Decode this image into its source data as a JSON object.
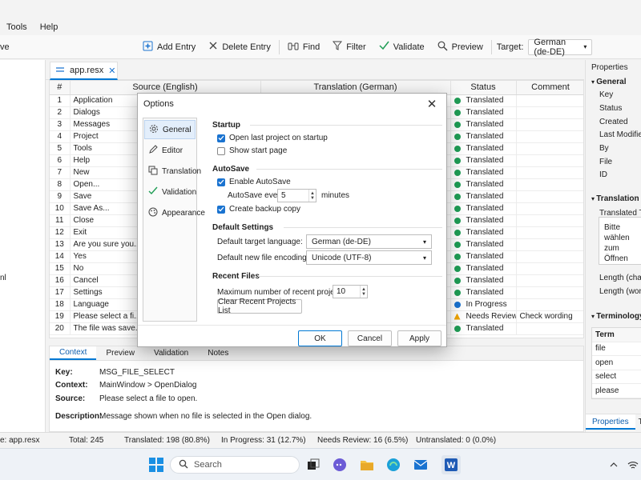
{
  "menu": {
    "tools": "Tools",
    "help": "Help"
  },
  "toolbar": {
    "left_fragment": "ve",
    "add_entry": "Add Entry",
    "delete_entry": "Delete Entry",
    "find": "Find",
    "filter": "Filter",
    "validate": "Validate",
    "preview": "Preview",
    "target_label": "Target:",
    "target_value": "German (de-DE)"
  },
  "left_pane": {
    "fragment": "nl"
  },
  "doc_tab": {
    "label": "app.resx"
  },
  "grid": {
    "headers": [
      "#",
      "Source (English)",
      "Translation (German)",
      "Status",
      "Comment"
    ],
    "rows": [
      {
        "n": "1",
        "src": "Application",
        "status": "Translated",
        "comment": ""
      },
      {
        "n": "2",
        "src": "Dialogs",
        "status": "Translated",
        "comment": ""
      },
      {
        "n": "3",
        "src": "Messages",
        "status": "Translated",
        "comment": ""
      },
      {
        "n": "4",
        "src": "Project",
        "status": "Translated",
        "comment": ""
      },
      {
        "n": "5",
        "src": "Tools",
        "status": "Translated",
        "comment": ""
      },
      {
        "n": "6",
        "src": "Help",
        "status": "Translated",
        "comment": ""
      },
      {
        "n": "7",
        "src": "New",
        "status": "Translated",
        "comment": ""
      },
      {
        "n": "8",
        "src": "Open...",
        "status": "Translated",
        "comment": ""
      },
      {
        "n": "9",
        "src": "Save",
        "status": "Translated",
        "comment": ""
      },
      {
        "n": "10",
        "src": "Save As...",
        "status": "Translated",
        "comment": ""
      },
      {
        "n": "11",
        "src": "Close",
        "status": "Translated",
        "comment": ""
      },
      {
        "n": "12",
        "src": "Exit",
        "status": "Translated",
        "comment": ""
      },
      {
        "n": "13",
        "src": "Are you sure you...",
        "status": "Translated",
        "comment": ""
      },
      {
        "n": "14",
        "src": "Yes",
        "status": "Translated",
        "comment": ""
      },
      {
        "n": "15",
        "src": "No",
        "status": "Translated",
        "comment": ""
      },
      {
        "n": "16",
        "src": "Cancel",
        "status": "Translated",
        "comment": ""
      },
      {
        "n": "17",
        "src": "Settings",
        "status": "Translated",
        "comment": ""
      },
      {
        "n": "18",
        "src": "Language",
        "status": "In Progress",
        "comment": ""
      },
      {
        "n": "19",
        "src": "Please select a fi...",
        "status": "Needs Review",
        "comment": "Check wording"
      },
      {
        "n": "20",
        "src": "The file was save...",
        "status": "Translated",
        "comment": ""
      }
    ]
  },
  "bottom": {
    "tabs": [
      "Context",
      "Preview",
      "Validation",
      "Notes"
    ],
    "key_label": "Key:",
    "key_value": "MSG_FILE_SELECT",
    "context_label": "Context:",
    "context_value": "MainWindow > OpenDialog",
    "source_label": "Source:",
    "source_value": "Please select a file to open.",
    "desc_label": "Description:",
    "desc_value": "Message shown when no file is selected in the Open dialog."
  },
  "properties": {
    "title": "Properties",
    "general": "General",
    "fields": [
      "Key",
      "Status",
      "Created",
      "Last Modified",
      "By",
      "File",
      "ID"
    ],
    "translation": "Translation",
    "translated_text": "Translated Tex",
    "box_text": "Bitte wählen zum Öffnen",
    "length_chars": "Length (chars)",
    "length_words": "Length (words",
    "terminology": "Terminology (",
    "term_header": "Term",
    "terms": [
      "file",
      "open",
      "select",
      "please"
    ],
    "tab_properties": "Properties",
    "tab_other": "Te"
  },
  "statusbar": {
    "file": "e: app.resx",
    "total": "Total: 245",
    "translated": "Translated: 198 (80.8%)",
    "in_progress": "In Progress: 31 (12.7%)",
    "needs_review": "Needs Review: 16 (6.5%)",
    "untranslated": "Untranslated: 0 (0.0%)"
  },
  "taskbar": {
    "search": "Search"
  },
  "dialog": {
    "title": "Options",
    "nav": [
      "General",
      "Editor",
      "Translation",
      "Validation",
      "Appearance"
    ],
    "startup": "Startup",
    "open_last": "Open last project on startup",
    "show_start": "Show start page",
    "autosave": "AutoSave",
    "enable_autosave": "Enable AutoSave",
    "autosave_every": "AutoSave every:",
    "autosave_value": "5",
    "minutes": "minutes",
    "backup": "Create backup copy",
    "defaults": "Default Settings",
    "target_lang_label": "Default target language:",
    "target_lang_value": "German (de-DE)",
    "encoding_label": "Default new file encoding:",
    "encoding_value": "Unicode (UTF-8)",
    "recent": "Recent Files",
    "max_recent_label": "Maximum number of recent projects:",
    "max_recent_value": "10",
    "clear_recent": "Clear Recent Projects List",
    "ok": "OK",
    "cancel": "Cancel",
    "apply": "Apply"
  },
  "colors": {
    "accent": "#0078d4",
    "translated": "#1f9d55",
    "in_progress": "#1a73d0",
    "needs_review": "#f0a500"
  }
}
